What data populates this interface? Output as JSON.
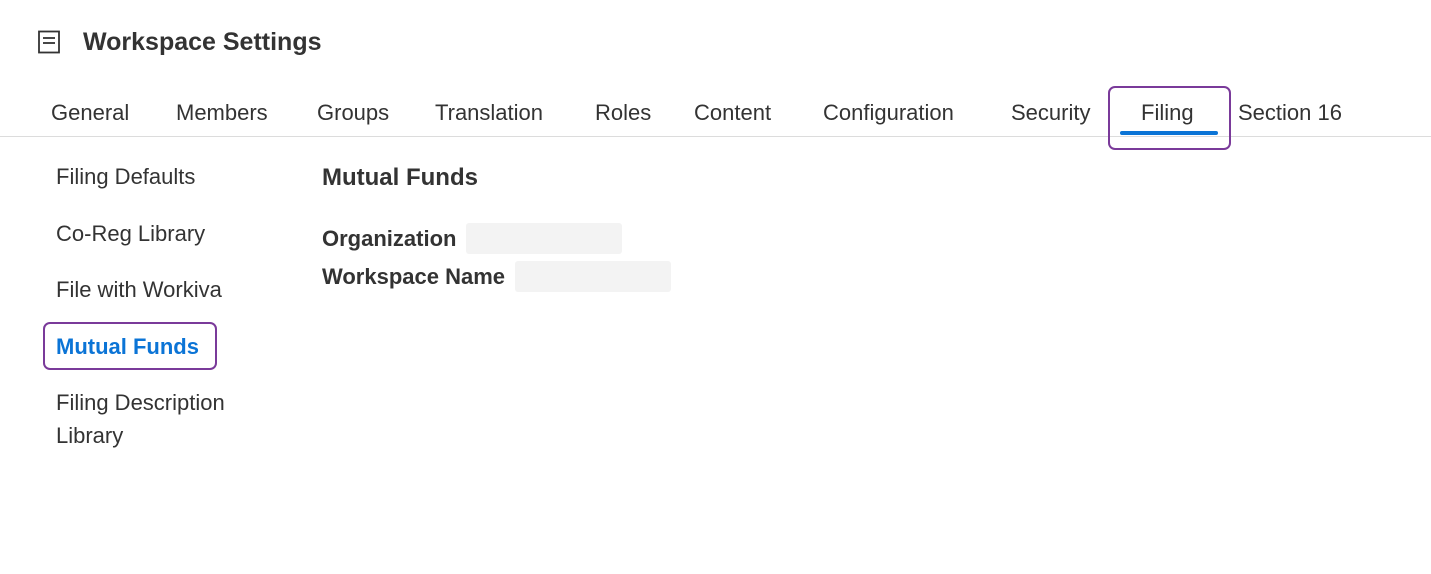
{
  "header": {
    "icon": "document-list-icon",
    "title": "Workspace Settings"
  },
  "tabs": [
    {
      "label": "General"
    },
    {
      "label": "Members"
    },
    {
      "label": "Groups"
    },
    {
      "label": "Translation"
    },
    {
      "label": "Roles"
    },
    {
      "label": "Content"
    },
    {
      "label": "Configuration"
    },
    {
      "label": "Security"
    },
    {
      "label": "Filing",
      "active": true
    },
    {
      "label": "Section 16"
    }
  ],
  "sidebar": {
    "items": [
      {
        "label": "Filing Defaults"
      },
      {
        "label": "Co-Reg Library"
      },
      {
        "label": "File with Workiva"
      },
      {
        "label": "Mutual Funds",
        "active": true
      },
      {
        "label": "Filing Description Library"
      }
    ]
  },
  "main": {
    "title": "Mutual Funds",
    "fields": [
      {
        "label": "Organization",
        "value": ""
      },
      {
        "label": "Workspace Name",
        "value": ""
      }
    ]
  },
  "colors": {
    "accent": "#0b74d6",
    "highlight": "#7a3a9a",
    "text": "#333333",
    "field_bg": "#f3f3f3"
  }
}
